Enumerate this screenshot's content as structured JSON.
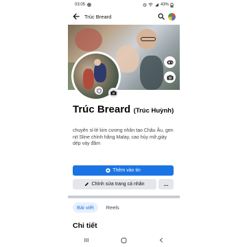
{
  "status_bar": {
    "time": "03:05",
    "battery": "43%"
  },
  "header": {
    "title": "Trúc Breard",
    "back_icon": "arrow-left-icon",
    "search_icon": "search-icon"
  },
  "profile": {
    "name": "Trúc Breard",
    "alternate_name": "(Trúc Huỳnh)",
    "bio": "chuyên sỉ-lẻ kim cương nhân tạo Châu Âu, gen nịt Sline chính hãng Malay, cao hủy mỡ,giày dép váy đầm"
  },
  "actions": {
    "add_story": "Thêm vào tin",
    "edit_profile": "Chỉnh sửa trang cá nhân",
    "more": "..."
  },
  "tabs": [
    {
      "label": "Bài viết",
      "active": true
    },
    {
      "label": "Reels",
      "active": false
    }
  ],
  "section": {
    "title": "Chi tiết"
  },
  "colors": {
    "accent": "#1b74e4",
    "button_secondary": "#e4e6eb"
  }
}
